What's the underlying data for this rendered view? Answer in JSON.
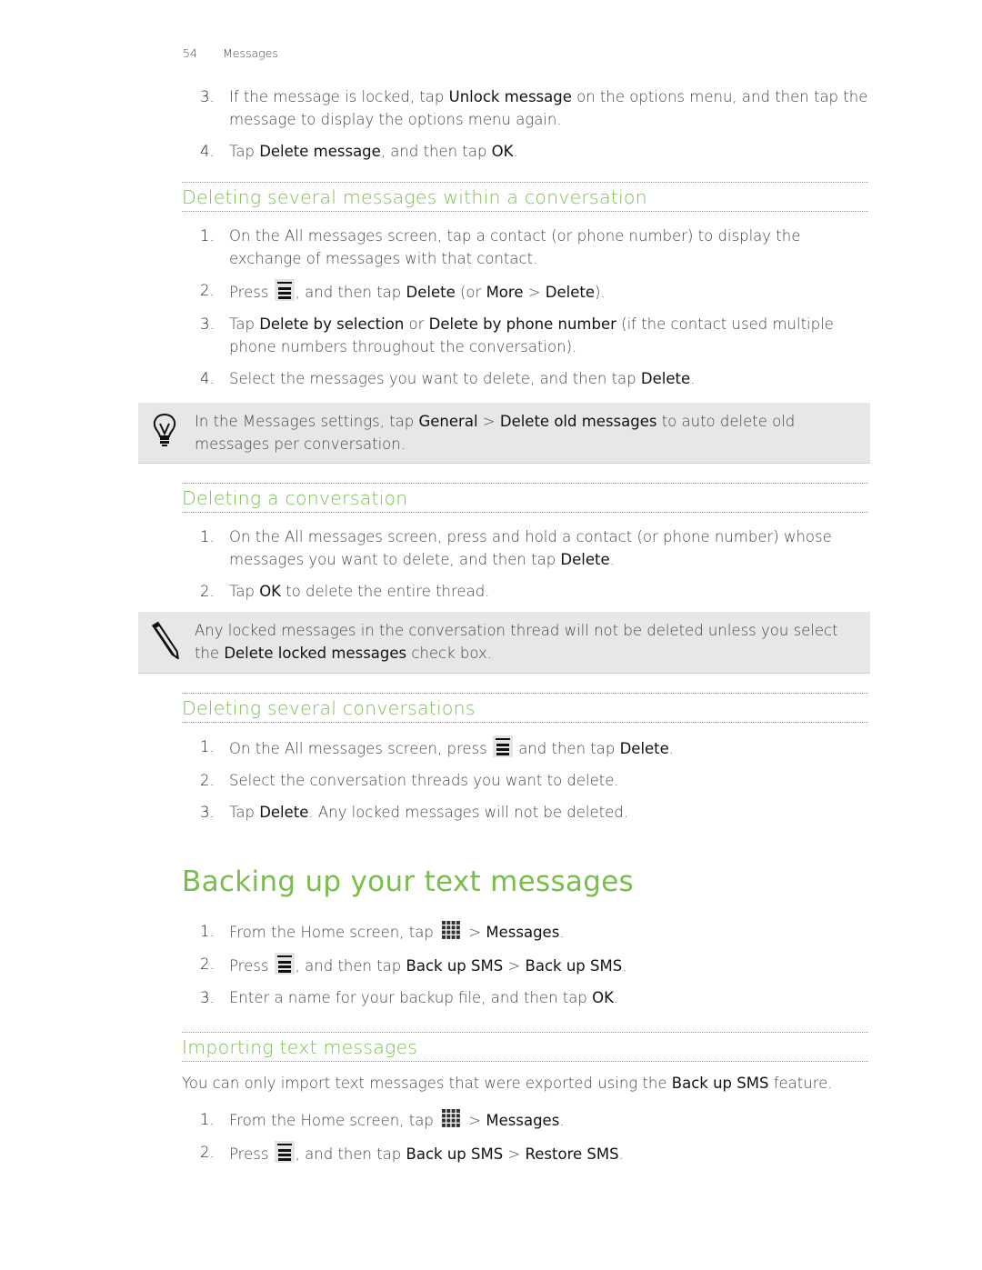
{
  "header": {
    "page_number": "54",
    "chapter": "Messages"
  },
  "top_steps": [
    {
      "n": "3.",
      "parts": [
        "If the message is locked, tap ",
        "Unlock message",
        " on the options menu, and then tap the message to display the options menu again."
      ]
    },
    {
      "n": "4.",
      "parts": [
        "Tap ",
        "Delete message",
        ", and then tap ",
        "OK",
        "."
      ]
    }
  ],
  "section_delete_several_messages": {
    "title": "Deleting several messages within a conversation",
    "steps": [
      {
        "n": "1.",
        "text": "On the All messages screen, tap a contact (or phone number) to display the exchange of messages with that contact."
      },
      {
        "n": "2.",
        "pre": "Press ",
        "icon": "menu-key-icon",
        "parts": [
          ", and then tap ",
          "Delete",
          " (or ",
          "More",
          " > ",
          "Delete",
          ")."
        ]
      },
      {
        "n": "3.",
        "parts": [
          "Tap ",
          "Delete by selection",
          " or ",
          "Delete by phone number",
          " (if the contact used multiple phone numbers throughout the conversation)."
        ]
      },
      {
        "n": "4.",
        "parts": [
          "Select the messages you want to delete, and then tap ",
          "Delete",
          "."
        ]
      }
    ],
    "tip": {
      "icon": "lightbulb-icon",
      "parts": [
        "In the Messages settings, tap ",
        "General",
        " > ",
        "Delete old messages",
        " to auto delete old messages per conversation."
      ]
    }
  },
  "section_delete_conversation": {
    "title": "Deleting a conversation",
    "steps": [
      {
        "n": "1.",
        "parts": [
          "On the All messages screen, press and hold a contact (or phone number) whose messages you want to delete, and then tap ",
          "Delete",
          "."
        ]
      },
      {
        "n": "2.",
        "parts": [
          "Tap ",
          "OK",
          " to delete the entire thread."
        ]
      }
    ],
    "note": {
      "icon": "pencil-icon",
      "parts": [
        "Any locked messages in the conversation thread will not be deleted unless you select the ",
        "Delete locked messages",
        " check box."
      ]
    }
  },
  "section_delete_several_conversations": {
    "title": "Deleting several conversations",
    "steps": [
      {
        "n": "1.",
        "pre": "On the All messages screen, press ",
        "icon": "menu-key-icon",
        "parts": [
          " and then tap ",
          "Delete",
          "."
        ]
      },
      {
        "n": "2.",
        "text": "Select the conversation threads you want to delete."
      },
      {
        "n": "3.",
        "parts": [
          "Tap ",
          "Delete",
          ". Any locked messages will not be deleted."
        ]
      }
    ]
  },
  "section_backup": {
    "title": "Backing up your text messages",
    "steps": [
      {
        "n": "1.",
        "pre": "From the Home screen, tap ",
        "icon": "all-apps-icon",
        "parts": [
          " > ",
          "Messages",
          "."
        ]
      },
      {
        "n": "2.",
        "pre": "Press ",
        "icon": "menu-key-icon",
        "parts": [
          ", and then tap ",
          "Back up SMS",
          " > ",
          "Back up SMS",
          "."
        ]
      },
      {
        "n": "3.",
        "parts": [
          "Enter a name for your backup file, and then tap ",
          "OK",
          "."
        ]
      }
    ]
  },
  "section_import": {
    "title": "Importing text messages",
    "intro_parts": [
      "You can only import text messages that were exported using the ",
      "Back up SMS",
      " feature."
    ],
    "steps": [
      {
        "n": "1.",
        "pre": "From the Home screen, tap ",
        "icon": "all-apps-icon",
        "parts": [
          " > ",
          "Messages",
          "."
        ]
      },
      {
        "n": "2.",
        "pre": "Press ",
        "icon": "menu-key-icon",
        "parts": [
          ", and then tap ",
          "Back up SMS",
          " > ",
          "Restore SMS",
          "."
        ]
      }
    ]
  },
  "colors": {
    "accent_green": "#7bbf4f",
    "note_bg": "#e6e7e8"
  }
}
